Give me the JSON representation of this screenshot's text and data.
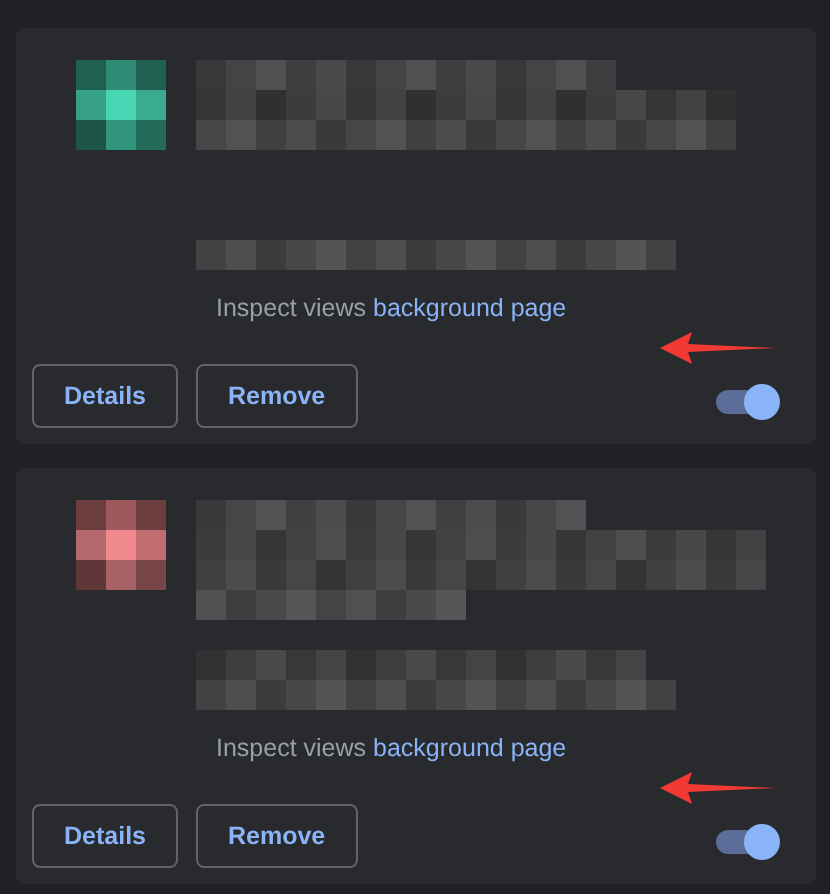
{
  "extensions": [
    {
      "color": "#48d6b4",
      "inspect_label": "Inspect views",
      "inspect_link": "background page",
      "enabled": true,
      "buttons": [
        "Details",
        "Remove"
      ]
    },
    {
      "color": "#f08a8f",
      "inspect_label": "Inspect views",
      "inspect_link": "background page",
      "enabled": true,
      "buttons": [
        "Details",
        "Remove"
      ]
    }
  ]
}
